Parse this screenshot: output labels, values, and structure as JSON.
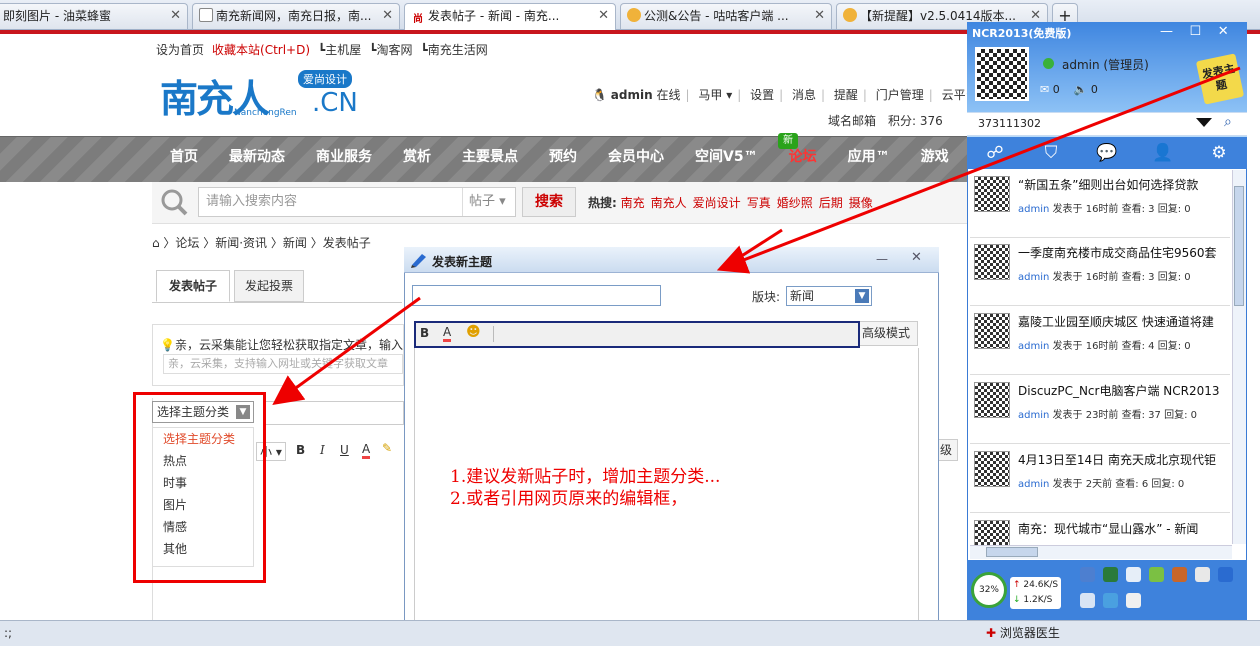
{
  "browser": {
    "tabs": [
      {
        "label": "即刻图片 - 油菜蜂蜜",
        "active": false
      },
      {
        "label": "南充新闻网，南充日报，南...",
        "active": false
      },
      {
        "label": "发表帖子 - 新闻 - 南充...",
        "active": true
      },
      {
        "label": "公测&公告 - 咕咕客户端 ...",
        "active": false
      },
      {
        "label": "【新提醒】v2.5.0414版本...",
        "active": false
      }
    ],
    "new_tab": "+",
    "status_left": ":;",
    "doctor": "浏览器医生"
  },
  "site": {
    "top_links": [
      "设为首页",
      "收藏本站(Ctrl+D)",
      "┗主机屋",
      "┗淘客网",
      "┗南充生活网"
    ],
    "logo": {
      "main": "南充人",
      "badge": "爱尚设计",
      "tld": ".CN",
      "sub": "NanchongRen"
    },
    "user": {
      "name": "admin",
      "status": "在线",
      "items": [
        "马甲",
        "设置",
        "消息",
        "提醒",
        "门户管理",
        "云平台"
      ]
    },
    "user2": "域名邮箱　积分: 376",
    "nav": [
      "首页",
      "最新动态",
      "商业服务",
      "赏析",
      "主要景点",
      "预约",
      "会员中心",
      "空间V5™",
      "论坛",
      "应用™",
      "游戏"
    ],
    "new_badge": "新",
    "search": {
      "placeholder": "请输入搜索内容",
      "type": "帖子",
      "button": "搜索",
      "hot_label": "热搜:",
      "hot": [
        "南充",
        "南充人",
        "爱尚设计",
        "写真",
        "婚纱照",
        "后期",
        "摄像"
      ]
    },
    "breadcrumb": "⌂ 〉论坛 〉新闻·资讯 〉新闻 〉发表帖子",
    "post_tabs": [
      "发表帖子",
      "发起投票"
    ],
    "tip": "亲，云采集能让您轻松获取指定文章，输入",
    "tip_input": "亲，云采集，支持输入网址或关键字获取文章",
    "category": {
      "selected": "选择主题分类",
      "options": [
        "选择主题分类",
        "热点",
        "时事",
        "图片",
        "情感",
        "其他"
      ]
    },
    "editor_tools": [
      "小",
      "B",
      "I",
      "U",
      "A"
    ],
    "editor_right": "级"
  },
  "dialog": {
    "title": "发表新主题",
    "section_label": "版块:",
    "section_value": "新闻",
    "tools": [
      "B",
      "A",
      "☻"
    ],
    "advanced": "高级模式"
  },
  "annotation": [
    "1.建议发新贴子时，增加主题分类...",
    "2.或者引用网页原来的编辑框，"
  ],
  "ncr": {
    "title": "NCR2013(免费版)",
    "user": "admin (管理员)",
    "mail": "0",
    "sound": "0",
    "badge": "发表主题",
    "id": "373111302",
    "items": [
      {
        "title": "“新国五条”细则出台如何选择贷款",
        "author": "admin",
        "when": "发表于 16时前",
        "views": "查看: 3",
        "replies": "回复: 0"
      },
      {
        "title": "一季度南充楼市成交商品住宅9560套",
        "author": "admin",
        "when": "发表于 16时前",
        "views": "查看: 3",
        "replies": "回复: 0"
      },
      {
        "title": "嘉陵工业园至顺庆城区 快速通道将建",
        "author": "admin",
        "when": "发表于 16时前",
        "views": "查看: 4",
        "replies": "回复: 0"
      },
      {
        "title": "DiscuzPC_Ncr电脑客户端 NCR2013",
        "author": "admin",
        "when": "发表于 23时前",
        "views": "查看: 37",
        "replies": "回复: 0"
      },
      {
        "title": "4月13日至14日 南充天成北京现代钜",
        "author": "admin",
        "when": "发表于 2天前",
        "views": "查看: 6",
        "replies": "回复: 0"
      },
      {
        "title": "南充：现代城市“显山露水” - 新闻",
        "author": "",
        "when": "",
        "views": "",
        "replies": ""
      }
    ],
    "cpu": "32%",
    "up": "24.6K/S",
    "down": "1.2K/S"
  },
  "colors": {
    "accent_red": "#c8161d",
    "ncr_blue": "#3e82dc",
    "annotation_red": "#ee0000"
  }
}
